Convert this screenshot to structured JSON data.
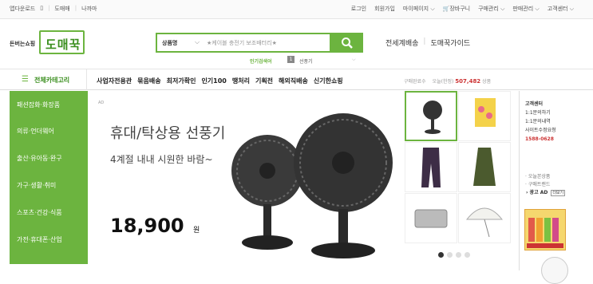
{
  "topbar": {
    "left": [
      "앱다운로드",
      "도매매",
      "나까마"
    ],
    "right": [
      "로그인",
      "회원가입",
      "마이페이지 ⌵",
      "장바구니",
      "구매관리 ⌵",
      "판매관리 ⌵",
      "고객센터 ⌵"
    ]
  },
  "header": {
    "logo_small": "돈버는쇼핑",
    "logo": "도매꾹",
    "search_category": "상품명",
    "search_caret": "⌵",
    "search_placeholder": "★케이블 충전기 보조배터리★",
    "hot_label": "인기검색어",
    "hot_rank": "1",
    "hot_keyword": "선풍기",
    "hot_arrow": "⌵",
    "links": [
      "전세계배송",
      "도매꾹가이드"
    ]
  },
  "nav": {
    "all_category": "전체카테고리",
    "menus": [
      "사업자전용관",
      "묶음배송",
      "최저가확인",
      "인기100",
      "땡처리",
      "기획전",
      "해외직배송",
      "신기한쇼핑"
    ],
    "notice": "구매완료수",
    "today_label": "오늘(한정)",
    "today_count": "507,482",
    "today_unit": "상품"
  },
  "side_categories": [
    "패션잡화·화장품",
    "의류·언더웨어",
    "출산·유아동·완구",
    "가구·생활·취미",
    "스포츠·건강·식품",
    "가전·휴대폰·산업"
  ],
  "banner": {
    "ad": "AD",
    "title": "휴대/탁상용 선풍기",
    "subtitle": "4계절 내내 시원한 바람~",
    "price": "18,900",
    "won": "원"
  },
  "customer_service": {
    "title": "고객센터",
    "items": [
      "1:1문의하기",
      "1:1문의내역",
      "사이트수정요청"
    ],
    "phone": "1588-0628"
  },
  "right_links": [
    "· 오늘본상품",
    "· 구매트랜드"
  ],
  "right_ad": "› 광고 AD",
  "right_ad_badge": "더보기",
  "icons": {
    "cart": "cart-icon",
    "search": "search-icon",
    "menu": "hamburger-icon"
  },
  "colors": {
    "brand": "#6cb43f",
    "brand_dark": "#3b8f1f",
    "price": "#c33"
  }
}
